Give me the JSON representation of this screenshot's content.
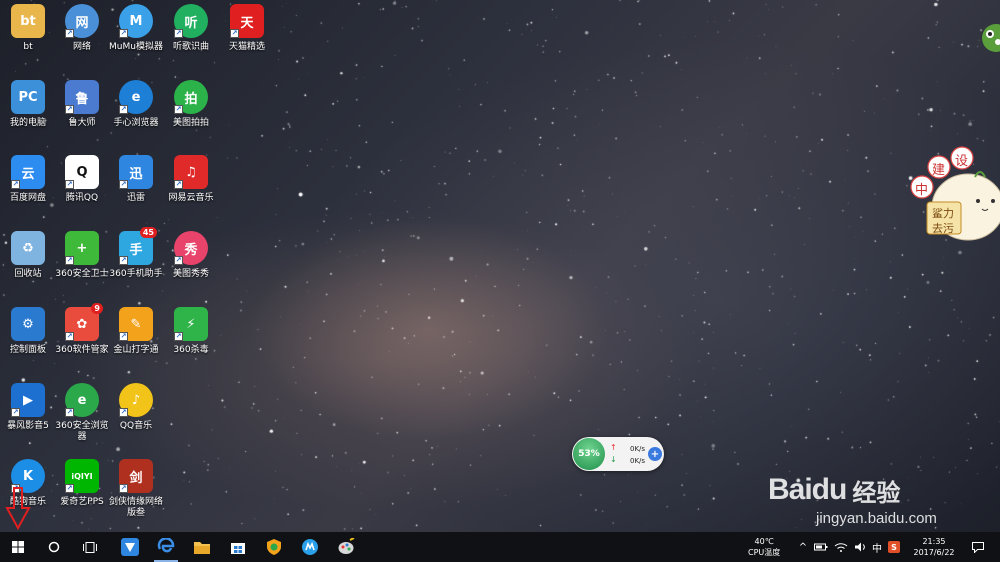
{
  "desktop": {
    "icons": [
      {
        "label": "bt",
        "color": "#e8b64a"
      },
      {
        "label": "网络",
        "color": "#4a90d9"
      },
      {
        "label": "MuMu模拟器",
        "color": "#3aa0e8"
      },
      {
        "label": "听歌识曲",
        "color": "#20b060"
      },
      {
        "label": "天猫精选",
        "color": "#e02020"
      },
      {
        "label": "我的电脑",
        "color": "#3c8fd9"
      },
      {
        "label": "鲁大师",
        "color": "#4a7bd1"
      },
      {
        "label": "手心浏览器",
        "color": "#1e7fd6"
      },
      {
        "label": "美图拍拍",
        "color": "#2bb34a"
      },
      {
        "label": "百度网盘",
        "color": "#2d8cf0"
      },
      {
        "label": "腾讯QQ",
        "color": "#ffffff"
      },
      {
        "label": "迅雷",
        "color": "#2f86e0"
      },
      {
        "label": "网易云音乐",
        "color": "#e02a2a"
      },
      {
        "label": "回收站",
        "color": "#7fb3e0"
      },
      {
        "label": "360安全卫士",
        "color": "#3fb93a"
      },
      {
        "label": "360手机助手",
        "color": "#2ea7e0",
        "badge": "45"
      },
      {
        "label": "美图秀秀",
        "color": "#e8436a"
      },
      {
        "label": "控制面板",
        "color": "#2a7ad0"
      },
      {
        "label": "360软件管家",
        "color": "#e94b3c",
        "badge": "9"
      },
      {
        "label": "金山打字通",
        "color": "#f2a21b"
      },
      {
        "label": "360杀毒",
        "color": "#2fb44a"
      },
      {
        "label": "暴风影音5",
        "color": "#1d6fd0"
      },
      {
        "label": "360安全浏览器",
        "color": "#2aa84a"
      },
      {
        "label": "QQ音乐",
        "color": "#f2c318"
      },
      {
        "label": "酷狗音乐",
        "color": "#1d8ee6"
      },
      {
        "label": "爱奇艺PPS",
        "color": "#00b600"
      },
      {
        "label": "剑侠情缘网络版叁",
        "color": "#b03020"
      }
    ],
    "glyphs": [
      "bt",
      "网",
      "M",
      "听",
      "天",
      "PC",
      "鲁",
      "e",
      "拍",
      "云",
      "Q",
      "迅",
      "♫",
      "♻",
      "+",
      "手",
      "秀",
      "⚙",
      "✿",
      "✎",
      "⚡",
      "▶",
      "e",
      "♪",
      "K",
      "iQIYI",
      "剑"
    ],
    "shortcut_glyph": "↗"
  },
  "netwidget": {
    "percent": "53%",
    "upload": "0K/s",
    "download": "0K/s",
    "plus": "+"
  },
  "sticker": {
    "chars": [
      "中",
      "建",
      "设"
    ],
    "tag_line1": "鲨力",
    "tag_line2": "去污"
  },
  "watermark": {
    "brand": "Baidu",
    "cn": "经验",
    "url": "jingyan.baidu.com"
  },
  "taskbar": {
    "start": "start-icon",
    "search": "cortana-icon",
    "taskview": "task-view-icon",
    "apps": [
      "xunlei-icon",
      "edge-icon",
      "file-explorer-icon",
      "store-icon",
      "browser-icon",
      "mumu-icon",
      "paint-icon"
    ]
  },
  "tray": {
    "temp": "40℃",
    "temp_label": "CPU温度",
    "chevron": "^",
    "ime": "中",
    "sogou": "S",
    "time": "21:35",
    "date": "2017/6/22",
    "notify": "▭"
  },
  "colors": {
    "taskbar": "#101114",
    "accent": "#8ab4e8",
    "arrow": "#e02020"
  }
}
